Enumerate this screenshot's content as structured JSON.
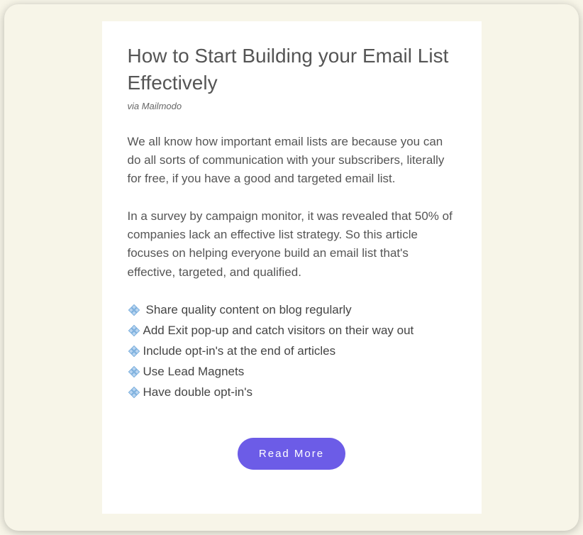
{
  "title": "How to Start Building your Email List Effectively",
  "attribution": "via Mailmodo",
  "paragraphs": [
    "We all know how important email lists are because you can do all sorts of communication with your subscribers, literally for free, if you have a good and targeted email list.",
    "In a survey by campaign monitor, it was revealed that 50% of companies lack an effective list strategy. So this article focuses on helping everyone build an email list that's effective, targeted, and qualified."
  ],
  "bullets": [
    " Share quality content on blog regularly",
    "Add Exit pop-up and catch visitors on their way out",
    "Include opt-in's at the end of articles",
    "Use Lead Magnets",
    "Have double opt-in's"
  ],
  "cta": "Read More",
  "colors": {
    "accent": "#6c5ce7",
    "background": "#f7f5e8"
  }
}
